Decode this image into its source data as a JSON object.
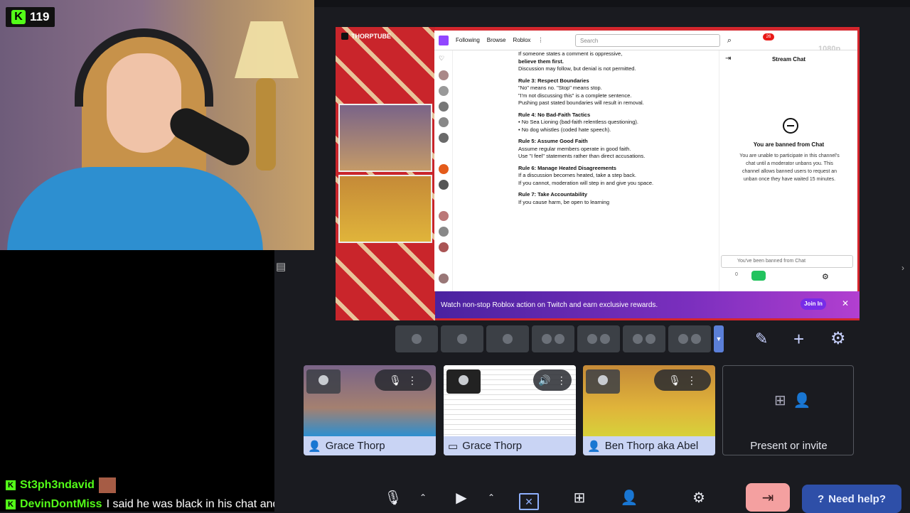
{
  "webcam": {
    "viewer_count": "119"
  },
  "chat": [
    {
      "user": "St3ph3ndavid",
      "message": ""
    },
    {
      "user": "DevinDontMiss",
      "message": "I said he was black in his chat and got banned so idk"
    }
  ],
  "presentation": {
    "channel_tag": "THORPTUBE",
    "twitch": {
      "nav": [
        "Following",
        "Browse",
        "Roblox"
      ],
      "search_placeholder": "Search",
      "quality": "1080p",
      "rules": [
        {
          "type": "text",
          "text": "If someone states a comment is oppressive,"
        },
        {
          "type": "bold",
          "text": "believe them first."
        },
        {
          "type": "text",
          "text": "Discussion may follow, but denial is not permitted."
        },
        {
          "type": "head",
          "text": "Rule 3: Respect Boundaries"
        },
        {
          "type": "text",
          "text": "\"No\" means no. \"Stop\" means stop."
        },
        {
          "type": "text",
          "text": "\"I'm not discussing this\" is a complete sentence."
        },
        {
          "type": "text",
          "text": "Pushing past stated boundaries will result in removal."
        },
        {
          "type": "head",
          "text": "Rule 4: No Bad-Faith Tactics"
        },
        {
          "type": "text",
          "text": "• No Sea Lioning (bad-faith relentless questioning)."
        },
        {
          "type": "text",
          "text": "• No dog whistles (coded hate speech)."
        },
        {
          "type": "head",
          "text": "Rule 5: Assume Good Faith"
        },
        {
          "type": "text",
          "text": "Assume regular members operate in good faith."
        },
        {
          "type": "text",
          "text": "Use \"I feel\" statements rather than direct accusations."
        },
        {
          "type": "head",
          "text": "Rule 6: Manage Heated Disagreements"
        },
        {
          "type": "text",
          "text": "If a discussion becomes heated, take a step back."
        },
        {
          "type": "text",
          "text": "If you cannot, moderation will step in and give you space."
        },
        {
          "type": "head",
          "text": "Rule 7: Take Accountability"
        },
        {
          "type": "text",
          "text": "If you cause harm, be open to learning"
        }
      ],
      "stream_chat_title": "Stream Chat",
      "ban_title": "You are banned from Chat",
      "ban_text": "You are unable to participate in this channel's chat until a moderator unbans you. This channel allows banned users to request an unban once they have waited 15 minutes.",
      "chat_input_placeholder": "You've been banned from Chat",
      "chat_count": "0",
      "banner_text": "Watch non-stop Roblox action on Twitch and earn exclusive rewards.",
      "banner_button": "Join In",
      "notif_count": "26"
    }
  },
  "tiles": [
    {
      "name": "Grace Thorp",
      "icon": "person-icon"
    },
    {
      "name": "Grace Thorp",
      "icon": "screen-share-icon"
    },
    {
      "name": "Ben Thorp aka Abel",
      "icon": "person-icon"
    }
  ],
  "present_invite": {
    "label": "Present or invite"
  },
  "bottom_bar": {
    "help_label": "Need help?"
  }
}
